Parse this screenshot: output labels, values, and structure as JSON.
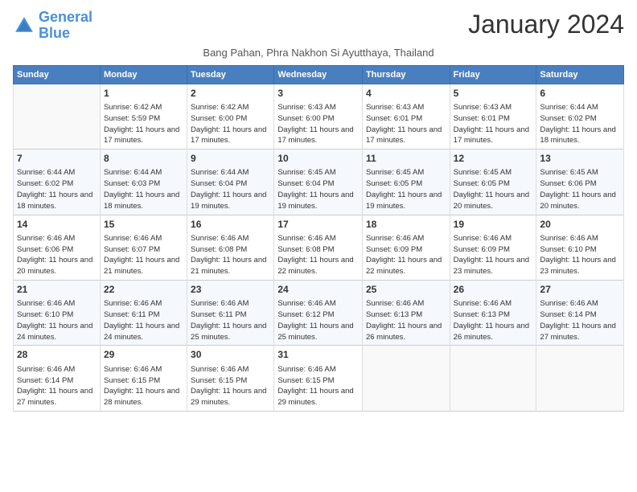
{
  "header": {
    "logo_line1": "General",
    "logo_line2": "Blue",
    "month_title": "January 2024",
    "subtitle": "Bang Pahan, Phra Nakhon Si Ayutthaya, Thailand"
  },
  "days_of_week": [
    "Sunday",
    "Monday",
    "Tuesday",
    "Wednesday",
    "Thursday",
    "Friday",
    "Saturday"
  ],
  "weeks": [
    [
      {
        "day": "",
        "sunrise": "",
        "sunset": "",
        "daylight": ""
      },
      {
        "day": "1",
        "sunrise": "Sunrise: 6:42 AM",
        "sunset": "Sunset: 5:59 PM",
        "daylight": "Daylight: 11 hours and 17 minutes."
      },
      {
        "day": "2",
        "sunrise": "Sunrise: 6:42 AM",
        "sunset": "Sunset: 6:00 PM",
        "daylight": "Daylight: 11 hours and 17 minutes."
      },
      {
        "day": "3",
        "sunrise": "Sunrise: 6:43 AM",
        "sunset": "Sunset: 6:00 PM",
        "daylight": "Daylight: 11 hours and 17 minutes."
      },
      {
        "day": "4",
        "sunrise": "Sunrise: 6:43 AM",
        "sunset": "Sunset: 6:01 PM",
        "daylight": "Daylight: 11 hours and 17 minutes."
      },
      {
        "day": "5",
        "sunrise": "Sunrise: 6:43 AM",
        "sunset": "Sunset: 6:01 PM",
        "daylight": "Daylight: 11 hours and 17 minutes."
      },
      {
        "day": "6",
        "sunrise": "Sunrise: 6:44 AM",
        "sunset": "Sunset: 6:02 PM",
        "daylight": "Daylight: 11 hours and 18 minutes."
      }
    ],
    [
      {
        "day": "7",
        "sunrise": "Sunrise: 6:44 AM",
        "sunset": "Sunset: 6:02 PM",
        "daylight": "Daylight: 11 hours and 18 minutes."
      },
      {
        "day": "8",
        "sunrise": "Sunrise: 6:44 AM",
        "sunset": "Sunset: 6:03 PM",
        "daylight": "Daylight: 11 hours and 18 minutes."
      },
      {
        "day": "9",
        "sunrise": "Sunrise: 6:44 AM",
        "sunset": "Sunset: 6:04 PM",
        "daylight": "Daylight: 11 hours and 19 minutes."
      },
      {
        "day": "10",
        "sunrise": "Sunrise: 6:45 AM",
        "sunset": "Sunset: 6:04 PM",
        "daylight": "Daylight: 11 hours and 19 minutes."
      },
      {
        "day": "11",
        "sunrise": "Sunrise: 6:45 AM",
        "sunset": "Sunset: 6:05 PM",
        "daylight": "Daylight: 11 hours and 19 minutes."
      },
      {
        "day": "12",
        "sunrise": "Sunrise: 6:45 AM",
        "sunset": "Sunset: 6:05 PM",
        "daylight": "Daylight: 11 hours and 20 minutes."
      },
      {
        "day": "13",
        "sunrise": "Sunrise: 6:45 AM",
        "sunset": "Sunset: 6:06 PM",
        "daylight": "Daylight: 11 hours and 20 minutes."
      }
    ],
    [
      {
        "day": "14",
        "sunrise": "Sunrise: 6:46 AM",
        "sunset": "Sunset: 6:06 PM",
        "daylight": "Daylight: 11 hours and 20 minutes."
      },
      {
        "day": "15",
        "sunrise": "Sunrise: 6:46 AM",
        "sunset": "Sunset: 6:07 PM",
        "daylight": "Daylight: 11 hours and 21 minutes."
      },
      {
        "day": "16",
        "sunrise": "Sunrise: 6:46 AM",
        "sunset": "Sunset: 6:08 PM",
        "daylight": "Daylight: 11 hours and 21 minutes."
      },
      {
        "day": "17",
        "sunrise": "Sunrise: 6:46 AM",
        "sunset": "Sunset: 6:08 PM",
        "daylight": "Daylight: 11 hours and 22 minutes."
      },
      {
        "day": "18",
        "sunrise": "Sunrise: 6:46 AM",
        "sunset": "Sunset: 6:09 PM",
        "daylight": "Daylight: 11 hours and 22 minutes."
      },
      {
        "day": "19",
        "sunrise": "Sunrise: 6:46 AM",
        "sunset": "Sunset: 6:09 PM",
        "daylight": "Daylight: 11 hours and 23 minutes."
      },
      {
        "day": "20",
        "sunrise": "Sunrise: 6:46 AM",
        "sunset": "Sunset: 6:10 PM",
        "daylight": "Daylight: 11 hours and 23 minutes."
      }
    ],
    [
      {
        "day": "21",
        "sunrise": "Sunrise: 6:46 AM",
        "sunset": "Sunset: 6:10 PM",
        "daylight": "Daylight: 11 hours and 24 minutes."
      },
      {
        "day": "22",
        "sunrise": "Sunrise: 6:46 AM",
        "sunset": "Sunset: 6:11 PM",
        "daylight": "Daylight: 11 hours and 24 minutes."
      },
      {
        "day": "23",
        "sunrise": "Sunrise: 6:46 AM",
        "sunset": "Sunset: 6:11 PM",
        "daylight": "Daylight: 11 hours and 25 minutes."
      },
      {
        "day": "24",
        "sunrise": "Sunrise: 6:46 AM",
        "sunset": "Sunset: 6:12 PM",
        "daylight": "Daylight: 11 hours and 25 minutes."
      },
      {
        "day": "25",
        "sunrise": "Sunrise: 6:46 AM",
        "sunset": "Sunset: 6:13 PM",
        "daylight": "Daylight: 11 hours and 26 minutes."
      },
      {
        "day": "26",
        "sunrise": "Sunrise: 6:46 AM",
        "sunset": "Sunset: 6:13 PM",
        "daylight": "Daylight: 11 hours and 26 minutes."
      },
      {
        "day": "27",
        "sunrise": "Sunrise: 6:46 AM",
        "sunset": "Sunset: 6:14 PM",
        "daylight": "Daylight: 11 hours and 27 minutes."
      }
    ],
    [
      {
        "day": "28",
        "sunrise": "Sunrise: 6:46 AM",
        "sunset": "Sunset: 6:14 PM",
        "daylight": "Daylight: 11 hours and 27 minutes."
      },
      {
        "day": "29",
        "sunrise": "Sunrise: 6:46 AM",
        "sunset": "Sunset: 6:15 PM",
        "daylight": "Daylight: 11 hours and 28 minutes."
      },
      {
        "day": "30",
        "sunrise": "Sunrise: 6:46 AM",
        "sunset": "Sunset: 6:15 PM",
        "daylight": "Daylight: 11 hours and 29 minutes."
      },
      {
        "day": "31",
        "sunrise": "Sunrise: 6:46 AM",
        "sunset": "Sunset: 6:15 PM",
        "daylight": "Daylight: 11 hours and 29 minutes."
      },
      {
        "day": "",
        "sunrise": "",
        "sunset": "",
        "daylight": ""
      },
      {
        "day": "",
        "sunrise": "",
        "sunset": "",
        "daylight": ""
      },
      {
        "day": "",
        "sunrise": "",
        "sunset": "",
        "daylight": ""
      }
    ]
  ]
}
